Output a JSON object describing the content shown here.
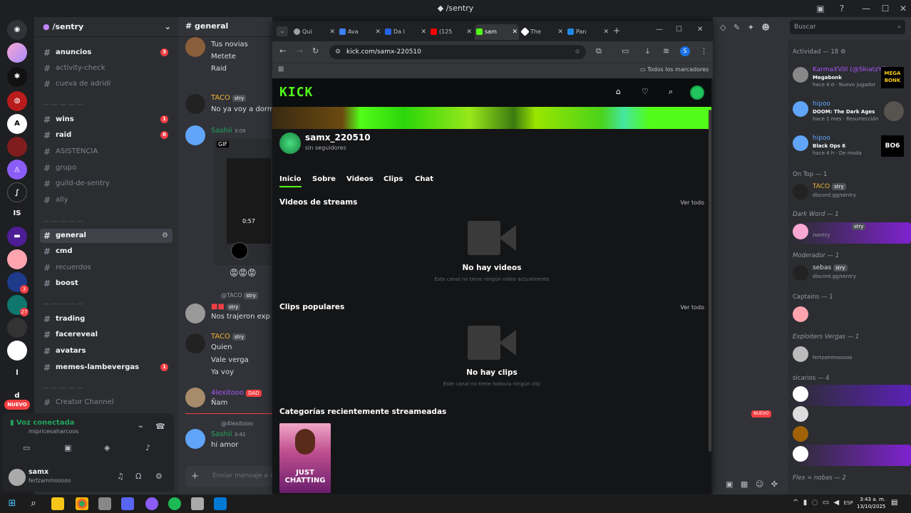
{
  "window": {
    "title": "/sentry"
  },
  "server_list": {
    "badges": [
      "3",
      "3",
      "27"
    ],
    "items": [
      "IS",
      "l",
      "d"
    ],
    "new_label": "NUEVO"
  },
  "channels": {
    "server_name": "/sentry",
    "items": [
      {
        "name": "anuncios",
        "badge": "3"
      },
      {
        "name": "activity-check"
      },
      {
        "name": "cueva de adridi"
      },
      {
        "name": "wins",
        "badge": "1"
      },
      {
        "name": "raid",
        "badge": "6"
      },
      {
        "name": "ASISTENCIA"
      },
      {
        "name": "grupo"
      },
      {
        "name": "guild-de-sentry"
      },
      {
        "name": "ally"
      },
      {
        "name": "general"
      },
      {
        "name": "cmd"
      },
      {
        "name": "recuerdos"
      },
      {
        "name": "boost"
      },
      {
        "name": "trading"
      },
      {
        "name": "facereveal"
      },
      {
        "name": "avatars"
      },
      {
        "name": "memes-lambevergas",
        "badge": "1"
      },
      {
        "name": "Creator Channel"
      }
    ]
  },
  "voice": {
    "status": "Voz conectada",
    "channel": "mipricesaharcoos"
  },
  "user": {
    "name": "samx",
    "status": "fertzammooooo"
  },
  "chat": {
    "channel": "general",
    "messages": [
      "Tus novias",
      "Metete",
      "Raid",
      "TACO",
      "No ya voy a dormir",
      "Sashii",
      "3:09",
      "GIF",
      "0:57",
      "@TACO",
      "Nos trajeron exp",
      "TACO",
      "Quien",
      "Vale verga",
      "Ya voy",
      "4lexitooo",
      "DAD",
      "Ñam",
      "@4lexitooo",
      "Sashii",
      "3:42",
      "hi amor"
    ],
    "input_placeholder": "Enviar mensaje a #"
  },
  "browser": {
    "tabs": [
      {
        "label": "Qui",
        "color": "#9aa0a6"
      },
      {
        "label": "Ava",
        "color": "#3b82f6"
      },
      {
        "label": "Da l",
        "color": "#2563eb"
      },
      {
        "label": "(125",
        "color": "#ff0000"
      },
      {
        "label": "sam",
        "color": "#53fc18"
      },
      {
        "label": "The",
        "color": "#ffffff"
      },
      {
        "label": "Pan",
        "color": "#1e88e5"
      }
    ],
    "url": "kick.com/samx-220510",
    "bookmarks_label": "Todos los marcadores"
  },
  "kick": {
    "logo": "KICK",
    "channel_name": "samx_220510",
    "followers": "sin seguidores",
    "tabs": [
      "Inicio",
      "Sobre",
      "Videos",
      "Clips",
      "Chat"
    ],
    "streams_title": "Videos de streams",
    "see_all": "Ver todo",
    "no_videos": "No hay videos",
    "no_videos_sub": "Este canal no tiene ningún video actualmente",
    "popular_clips": "Clips populares",
    "no_clips": "No hay clips",
    "no_clips_sub": "Este canal no tiene todavía ningún clip",
    "categories_title": "Categorías recientemente streameadas",
    "category_art": "JUST CHATTING"
  },
  "members": {
    "search_placeholder": "Buscar",
    "activity_header": "Actividad — 18",
    "activities": [
      {
        "user": "KarmaXVIII (@SkiatzYT...",
        "game": "Megabonk",
        "meta": "hace 4 d",
        "extra": "Nuevo jugador",
        "art": "MEGA BONK"
      },
      {
        "user": "hipoo",
        "game": "DOOM: The Dark Ages",
        "meta": "hace 1 mes",
        "extra": "Resurrección"
      },
      {
        "user": "hipoo",
        "game": "Black Ops 6",
        "meta": "hace 4 h",
        "extra": "De moda",
        "art": "BO6"
      }
    ],
    "groups": [
      {
        "label": "On Top — 1"
      },
      {
        "name": "TACO",
        "tag": "stry",
        "sub": "discord.gg/sentry"
      },
      {
        "label": "Dark Word — 1"
      },
      {
        "name": "",
        "tag": "stry",
        "sub": "/sentry"
      },
      {
        "label": "Moderador — 1"
      },
      {
        "name": "sebas",
        "tag": "stry",
        "sub": "discord.gg/sentry"
      },
      {
        "label": "Captains — 1"
      },
      {
        "label": "Exploiters Vergas — 1"
      },
      {
        "name": "",
        "sub": "fertzammooooo"
      },
      {
        "label": "sicarios — 4"
      },
      {
        "label": "Flex = nobas — 2"
      }
    ]
  },
  "taskbar": {
    "lang": "ESP",
    "time": "3:43 a. m.",
    "date": "13/10/2025"
  },
  "colors": {
    "kick_green": "#53fc18",
    "discord_bg": "#313338",
    "badge_red": "#f23f43",
    "selected": "#404249"
  }
}
